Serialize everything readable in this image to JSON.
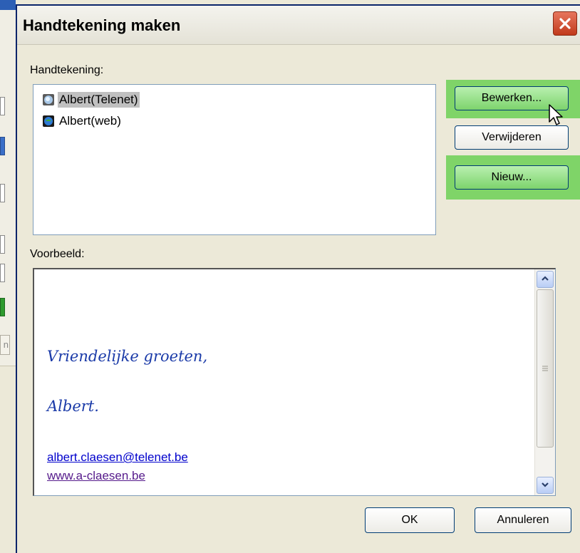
{
  "dialog": {
    "title": "Handtekening maken",
    "close_icon": "close-icon"
  },
  "signatures": {
    "label": "Handtekening:",
    "items": [
      {
        "label": "Albert(Telenet)",
        "icon": "signature-icon",
        "selected": true
      },
      {
        "label": "Albert(web)",
        "icon": "signature-icon",
        "selected": false
      }
    ]
  },
  "buttons": {
    "edit": "Bewerken...",
    "delete": "Verwijderen",
    "new": "Nieuw...",
    "ok": "OK",
    "cancel": "Annuleren"
  },
  "preview": {
    "label": "Voorbeeld:",
    "greeting": "Vriendelijke groeten,",
    "name": "Albert.",
    "email": "albert.claesen@telenet.be",
    "website": "www.a-claesen.be"
  },
  "colors": {
    "highlight": "#7fd468",
    "signature_text": "#1a3aa8",
    "email_link": "#0000cc",
    "web_link": "#551a8b"
  },
  "background_left": {
    "partial_text": "n"
  }
}
